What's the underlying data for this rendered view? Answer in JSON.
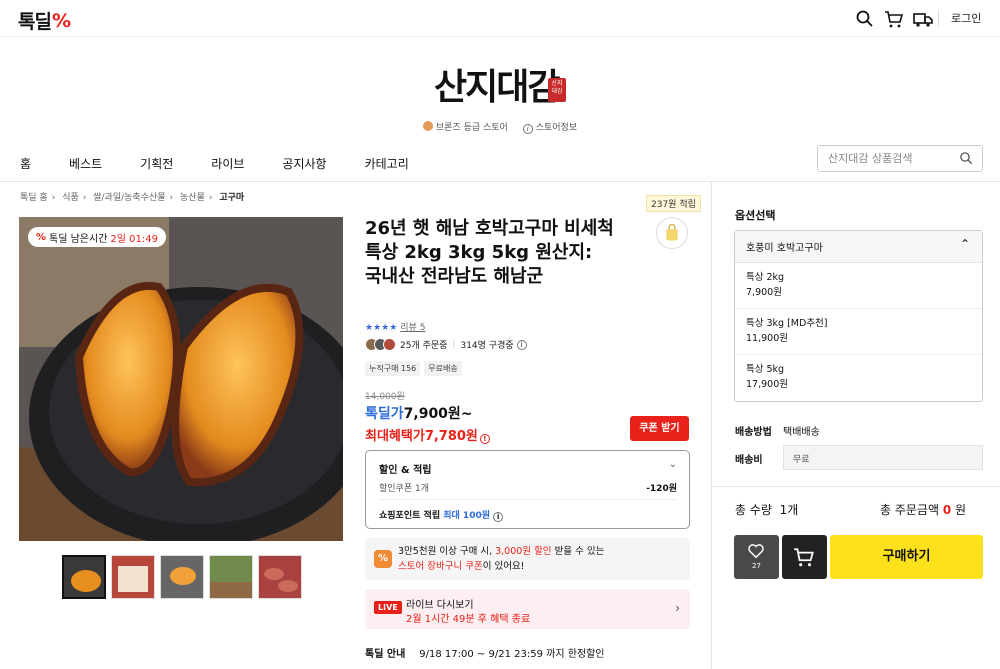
{
  "topbar": {
    "logo_text": "톡딜",
    "logo_mark": "%",
    "login_label": "로그인",
    "icons": [
      "search-icon",
      "cart-icon",
      "truck-icon"
    ]
  },
  "store": {
    "name": "산지대감",
    "seal_text": "산지\n대감",
    "grade": "브론즈 등급 스토어",
    "info": "스토어정보"
  },
  "nav": {
    "items": [
      "홈",
      "베스트",
      "기획전",
      "라이브",
      "공지사항",
      "카테고리"
    ],
    "search_placeholder": "산지대감 상품검색"
  },
  "breadcrumb": [
    "톡딜 홈",
    "식품",
    "쌀/과일/농축수산물",
    "농산물",
    "고구마"
  ],
  "product": {
    "timer_label": "톡딜 남은시간",
    "timer_value": "2일 01:49",
    "points_badge": "237원 적립",
    "title": "26년 햇 해남 호박고구마 비세척 특상 2kg 3kg 5kg 원산지: 국내산 전라남도 해남군",
    "stars": "★★★★",
    "review_label": "리뷰 5",
    "order_count": "25개 주문중",
    "viewer_count": "314명 구경중",
    "tags": [
      "누적구매 156",
      "무료배송"
    ],
    "original_price": "14,000원",
    "deal_label": "톡딜가",
    "deal_price": "7,900원~",
    "benefit_label": "최대혜택가",
    "benefit_price": "7,780원",
    "coupon_button": "쿠폰 받기"
  },
  "discount": {
    "title": "할인 & 적립",
    "coupon_label": "할인쿠폰 1개",
    "coupon_value": "-120원",
    "point_label": "쇼핑포인트 적립",
    "point_value": "최대 100원"
  },
  "promo": {
    "line1_a": "3만5천원 이상 구매 시, ",
    "line1_b": "3,000원 할인",
    "line1_c": " 받을 수 있는",
    "line2_a": "스토어 장바구니 쿠폰",
    "line2_b": "이 있어요!"
  },
  "live": {
    "badge": "LIVE",
    "title": "라이브 다시보기",
    "subtitle": "2월 1시간 49분 후 혜택 종료"
  },
  "deal_info": {
    "label": "톡딜 안내",
    "value": "9/18 17:00 ~ 9/21 23:59 까지 한정할인"
  },
  "options": {
    "title": "옵션선택",
    "selected": "호풍미 호박고구마",
    "items": [
      {
        "name": "특상 2kg",
        "price": "7,900원"
      },
      {
        "name": "특상 3kg [MD추천]",
        "price": "11,900원"
      },
      {
        "name": "특상 5kg",
        "price": "17,900원"
      }
    ]
  },
  "shipping": {
    "method_label": "배송방법",
    "method_value": "택배배송",
    "fee_label": "배송비",
    "fee_value": "무료"
  },
  "summary": {
    "qty_label": "총 수량",
    "qty_value": "1개",
    "total_label": "총 주문금액",
    "total_value": "0",
    "total_unit": "원"
  },
  "actions": {
    "like_count": "27",
    "buy_label": "구매하기"
  },
  "colors": {
    "accent_red": "#e8221a",
    "deal_blue": "#2c6bd9",
    "buy_yellow": "#fde21b"
  }
}
